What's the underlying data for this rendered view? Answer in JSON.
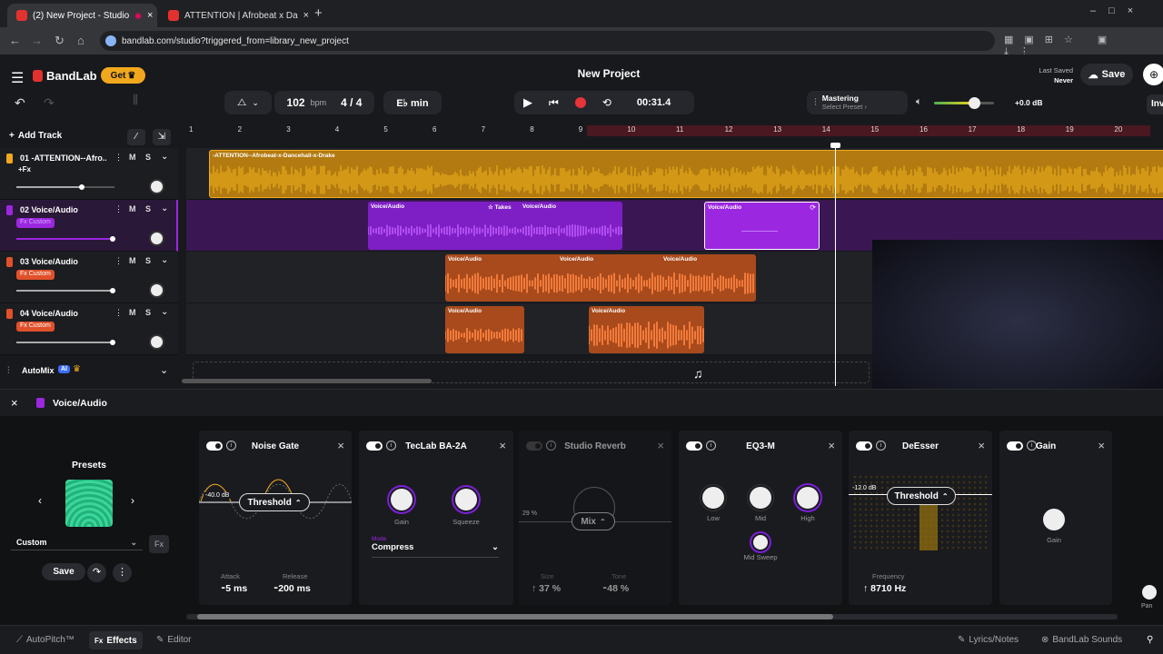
{
  "browser": {
    "tabs": [
      {
        "label": "(2) New Project - Studio",
        "active": true
      },
      {
        "label": "ATTENTION | Afrobeat x Da",
        "active": false
      }
    ],
    "url": "bandlab.com/studio?triggered_from=library_new_project"
  },
  "header": {
    "brand": "BandLab",
    "get_label": "Get",
    "project_title": "New Project",
    "last_saved_label": "Last Saved",
    "last_saved_value": "Never",
    "save_label": "Save",
    "invite_label": "Inv"
  },
  "transport": {
    "tempo": "102",
    "tempo_unit": "bpm",
    "time_signature": "4 / 4",
    "key": "E♭ min",
    "time": "00:31.4",
    "mastering_label": "Mastering",
    "mastering_preset": "Select Preset",
    "master_volume": "+0.0 dB"
  },
  "ruler": [
    "1",
    "2",
    "3",
    "4",
    "5",
    "6",
    "7",
    "8",
    "9",
    "10",
    "11",
    "12",
    "13",
    "14",
    "15",
    "16",
    "17",
    "18",
    "19",
    "20"
  ],
  "tracks_toolbar": {
    "add_track": "Add Track"
  },
  "tracks": [
    {
      "number": "01",
      "name": "-ATTENTION--Afro...",
      "badge": "+Fx",
      "mute": "M",
      "solo": "S",
      "volume": 0.68,
      "color": "#f2a81d"
    },
    {
      "number": "02",
      "name": "Voice/Audio",
      "badge": "Fx Custom",
      "mute": "M",
      "solo": "S",
      "volume": 1.0,
      "color": "#9b27e0"
    },
    {
      "number": "03",
      "name": "Voice/Audio",
      "badge": "Fx Custom",
      "mute": "M",
      "solo": "S",
      "volume": 1.0,
      "color": "#e0512a"
    },
    {
      "number": "04",
      "name": "Voice/Audio",
      "badge": "Fx Custom",
      "mute": "M",
      "solo": "S",
      "volume": 1.0,
      "color": "#e0512a"
    }
  ],
  "clips": {
    "track1": "-ATTENTION--Afrobeat-x-Dancehall-x-Drake",
    "takes": "Takes",
    "voice": "Voice/Audio"
  },
  "automix": {
    "label": "AutoMix",
    "ai": "AI"
  },
  "effects_panel": {
    "track_name": "Voice/Audio",
    "presets_title": "Presets",
    "preset_value": "Custom",
    "save_label": "Save",
    "cards": {
      "noise_gate": {
        "title": "Noise Gate",
        "threshold_label": "Threshold",
        "threshold_value": "-40.0 dB",
        "attack_label": "Attack",
        "attack_value": "5 ms",
        "release_label": "Release",
        "release_value": "200 ms"
      },
      "tec": {
        "title": "TecLab BA-2A",
        "gain_label": "Gain",
        "squeeze_label": "Squeeze",
        "mode_label": "Mode",
        "mode_value": "Compress"
      },
      "reverb": {
        "title": "Studio Reverb",
        "mix_label": "Mix",
        "mix_value": "29 %",
        "size_label": "Size",
        "size_value": "37 %",
        "tone_label": "Tone",
        "tone_value": "48 %"
      },
      "eq": {
        "title": "EQ3-M",
        "low_label": "Low",
        "mid_label": "Mid",
        "high_label": "High",
        "sweep_label": "Mid Sweep"
      },
      "deesser": {
        "title": "DeEsser",
        "threshold_label": "Threshold",
        "threshold_value": "-12.0 dB",
        "freq_label": "Frequency",
        "freq_value": "8710 Hz"
      },
      "gain": {
        "title": "Gain",
        "gain_label": "Gain"
      }
    },
    "pan_label": "Pan"
  },
  "footer": {
    "autopitch": "AutoPitch™",
    "effects": "Effects",
    "editor": "Editor",
    "lyrics": "Lyrics/Notes",
    "sounds": "BandLab Sounds"
  },
  "colors": {
    "accent": "#f2a81d",
    "purple": "#9b27e0",
    "orange": "#e0512a",
    "record": "#e8343a",
    "brand_red": "#e2322f"
  }
}
